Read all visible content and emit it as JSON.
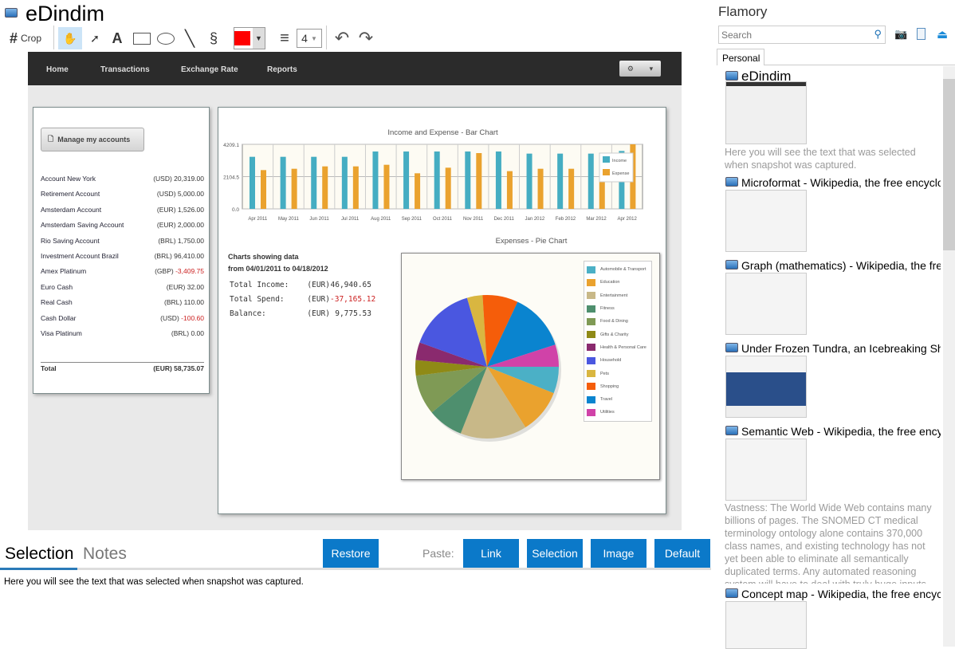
{
  "app": {
    "title": "eDindim"
  },
  "toolbar": {
    "crop_label": "Crop",
    "line_width": "4",
    "color": "#ff0000"
  },
  "snapshot": {
    "nav": [
      "Home",
      "Transactions",
      "Exchange Rate",
      "Reports"
    ],
    "manage_button": "Manage my accounts",
    "accounts": [
      {
        "name": "Account New York",
        "cur": "(USD)",
        "amt": "20,319.00",
        "neg": false
      },
      {
        "name": "Retirement Account",
        "cur": "(USD)",
        "amt": "5,000.00",
        "neg": false
      },
      {
        "name": "Amsterdam Account",
        "cur": "(EUR)",
        "amt": "1,526.00",
        "neg": false
      },
      {
        "name": "Amsterdam Saving Account",
        "cur": "(EUR)",
        "amt": "2,000.00",
        "neg": false
      },
      {
        "name": "Rio Saving Account",
        "cur": "(BRL)",
        "amt": "1,750.00",
        "neg": false
      },
      {
        "name": "Investment Account Brazil",
        "cur": "(BRL)",
        "amt": "96,410.00",
        "neg": false
      },
      {
        "name": "Amex Platinum",
        "cur": "(GBP)",
        "amt": "-3,409.75",
        "neg": true
      },
      {
        "name": "Euro Cash",
        "cur": "(EUR)",
        "amt": "32.00",
        "neg": false
      },
      {
        "name": "Real Cash",
        "cur": "(BRL)",
        "amt": "110.00",
        "neg": false
      },
      {
        "name": "Cash Dollar",
        "cur": "(USD)",
        "amt": "-100.60",
        "neg": true
      },
      {
        "name": "Visa Platinum",
        "cur": "(BRL)",
        "amt": "0.00",
        "neg": false
      }
    ],
    "total_label": "Total",
    "total_value": "(EUR) 58,735.07",
    "summary": {
      "heading1": "Charts showing data",
      "heading2": "from 04/01/2011 to 04/18/2012",
      "rows": [
        {
          "label": "Total Income:",
          "cur": "(EUR)",
          "val": "46,940.65"
        },
        {
          "label": "Total Spend:",
          "cur": "(EUR)",
          "val": "-37,165.12"
        },
        {
          "label": "Balance:",
          "cur": "(EUR)",
          "val": "9,775.53"
        }
      ]
    }
  },
  "chart_data": [
    {
      "type": "bar",
      "title": "Income and Expense - Bar Chart",
      "categories": [
        "Apr 2011",
        "May 2011",
        "Jun 2011",
        "Jul 2011",
        "Aug 2011",
        "Sep 2011",
        "Oct 2011",
        "Nov 2011",
        "Dec 2011",
        "Jan 2012",
        "Feb 2012",
        "Mar 2012",
        "Apr 2012"
      ],
      "yticks": [
        "0.0",
        "2104.5",
        "4209.1"
      ],
      "ylim": [
        0,
        4209.1
      ],
      "legend": "top-right",
      "series": [
        {
          "name": "Income",
          "color": "#45adc2",
          "values": [
            3395,
            3395,
            3395,
            3395,
            3741,
            3741,
            3741,
            3741,
            3741,
            3603,
            3603,
            3603,
            3776
          ]
        },
        {
          "name": "Expense",
          "color": "#eaa22e",
          "values": [
            2529,
            2615,
            2771,
            2771,
            2875,
            2321,
            2685,
            3637,
            2460,
            2615,
            2615,
            2477,
            4209
          ]
        }
      ]
    },
    {
      "type": "pie",
      "title": "Expenses - Pie Chart",
      "legend": "top-right",
      "slices": [
        {
          "label": "Automobile & Transport",
          "value": 6,
          "color": "#4bb0c6"
        },
        {
          "label": "Education",
          "value": 10,
          "color": "#eaa22e"
        },
        {
          "label": "Entertainment",
          "value": 15,
          "color": "#c8b888"
        },
        {
          "label": "Fitness",
          "value": 8,
          "color": "#4e8f6e"
        },
        {
          "label": "Food & Dining",
          "value": 9,
          "color": "#7f9a55"
        },
        {
          "label": "Gifts & Charity",
          "value": 3.5,
          "color": "#8f8a16"
        },
        {
          "label": "Health & Personal Care",
          "value": 4,
          "color": "#8a2a6e"
        },
        {
          "label": "Household",
          "value": 15,
          "color": "#4a57e0"
        },
        {
          "label": "Pets",
          "value": 3.5,
          "color": "#d9b640"
        },
        {
          "label": "Shopping",
          "value": 8,
          "color": "#f55d0a"
        },
        {
          "label": "Travel",
          "value": 13,
          "color": "#0a84cf"
        },
        {
          "label": "Utilities",
          "value": 5,
          "color": "#d042a8"
        }
      ]
    }
  ],
  "bottom": {
    "tab_selection": "Selection",
    "tab_notes": "Notes",
    "restore": "Restore",
    "paste_label": "Paste:",
    "paste_buttons": [
      "Link",
      "Selection",
      "Image",
      "Default"
    ],
    "selection_text": "Here you will see the text that was selected when snapshot was captured."
  },
  "sidebar": {
    "title": "Flamory",
    "search_placeholder": "Search",
    "tab": "Personal",
    "items": [
      {
        "title": "eDindim",
        "desc": "Here you will see the text that was selected when snapshot was captured."
      },
      {
        "title": "Microformat - Wikipedia, the free encyclopedia"
      },
      {
        "title": "Graph (mathematics) - Wikipedia, the free ency"
      },
      {
        "title": "Under Frozen Tundra, an Icebreaking Ship Unco"
      },
      {
        "title": "Semantic Web - Wikipedia, the free encycloped",
        "desc": "Vastness: The World Wide Web contains many billions of pages. The SNOMED CT medical terminology ontology alone contains 370,000 class names, and existing technology has not yet been able to eliminate all semantically duplicated terms. Any automated reasoning system will have to deal with truly huge inputs."
      },
      {
        "title": "Concept map - Wikipedia, the free encyclopedia"
      }
    ]
  }
}
